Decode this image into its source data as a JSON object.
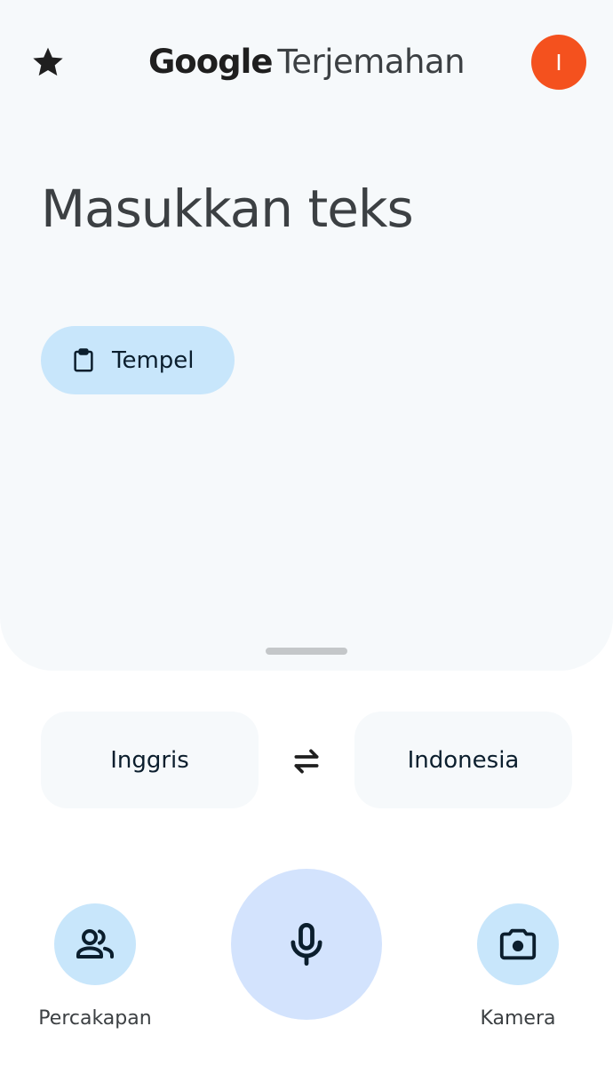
{
  "header": {
    "brand": "Google",
    "product": "Terjemahan",
    "avatar_initial": "I"
  },
  "input": {
    "placeholder": "Masukkan teks",
    "value": ""
  },
  "paste": {
    "label": "Tempel",
    "icon": "clipboard-icon"
  },
  "languages": {
    "source": "Inggris",
    "target": "Indonesia",
    "swap_icon": "swap-arrows-icon"
  },
  "actions": {
    "conversation_label": "Percakapan",
    "camera_label": "Kamera",
    "mic_icon": "microphone-icon"
  },
  "colors": {
    "panel_bg": "#f6f9fb",
    "accent_light": "#c8e6fb",
    "mic_bg": "#d3e3fd",
    "avatar_bg": "#f4511e",
    "icon_dark": "#0b1e2d"
  }
}
